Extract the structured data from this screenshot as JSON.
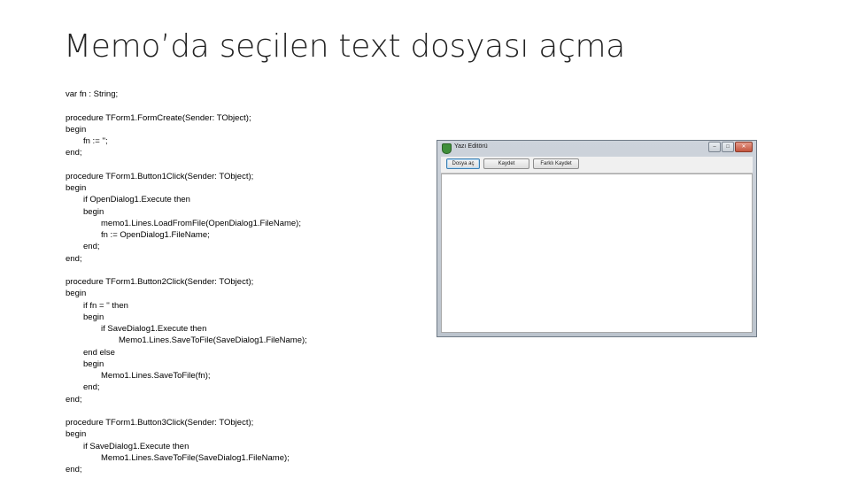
{
  "slide": {
    "title": "Memo’da seçilen text dosyası açma"
  },
  "code_lines": [
    {
      "text": "var fn : String;",
      "indent": 0
    },
    {
      "text": "",
      "indent": 0
    },
    {
      "text": "procedure TForm1.FormCreate(Sender: TObject);",
      "indent": 0
    },
    {
      "text": "begin",
      "indent": 0
    },
    {
      "text": "fn := '';",
      "indent": 1
    },
    {
      "text": "end;",
      "indent": 0
    },
    {
      "text": "",
      "indent": 0
    },
    {
      "text": "procedure TForm1.Button1Click(Sender: TObject);",
      "indent": 0
    },
    {
      "text": "begin",
      "indent": 0
    },
    {
      "text": "if OpenDialog1.Execute then",
      "indent": 1
    },
    {
      "text": "begin",
      "indent": 1
    },
    {
      "text": "memo1.Lines.LoadFromFile(OpenDialog1.FileName);",
      "indent": 2
    },
    {
      "text": "fn := OpenDialog1.FileName;",
      "indent": 2
    },
    {
      "text": "end;",
      "indent": 1
    },
    {
      "text": "end;",
      "indent": 0
    },
    {
      "text": "",
      "indent": 0
    },
    {
      "text": "procedure TForm1.Button2Click(Sender: TObject);",
      "indent": 0
    },
    {
      "text": "begin",
      "indent": 0
    },
    {
      "text": "if fn = '' then",
      "indent": 1
    },
    {
      "text": "begin",
      "indent": 1
    },
    {
      "text": "if SaveDialog1.Execute then",
      "indent": 2
    },
    {
      "text": "Memo1.Lines.SaveToFile(SaveDialog1.FileName);",
      "indent": 3
    },
    {
      "text": "end else",
      "indent": 1
    },
    {
      "text": "begin",
      "indent": 1
    },
    {
      "text": "Memo1.Lines.SaveToFile(fn);",
      "indent": 2
    },
    {
      "text": "end;",
      "indent": 1
    },
    {
      "text": "end;",
      "indent": 0
    },
    {
      "text": "",
      "indent": 0
    },
    {
      "text": "procedure TForm1.Button3Click(Sender: TObject);",
      "indent": 0
    },
    {
      "text": "begin",
      "indent": 0
    },
    {
      "text": "if SaveDialog1.Execute then",
      "indent": 1
    },
    {
      "text": "Memo1.Lines.SaveToFile(SaveDialog1.FileName);",
      "indent": 2
    },
    {
      "text": "end;",
      "indent": 0
    }
  ],
  "window": {
    "title": "Yazı Editörü",
    "icon": "app-icon",
    "controls": {
      "minimize": "–",
      "maximize": "□",
      "close": "✕"
    },
    "buttons": [
      {
        "name": "open-button",
        "label": "Dosya aç"
      },
      {
        "name": "save-button",
        "label": "Kaydet"
      },
      {
        "name": "save-as-button",
        "label": "Farklı Kaydet"
      }
    ]
  }
}
